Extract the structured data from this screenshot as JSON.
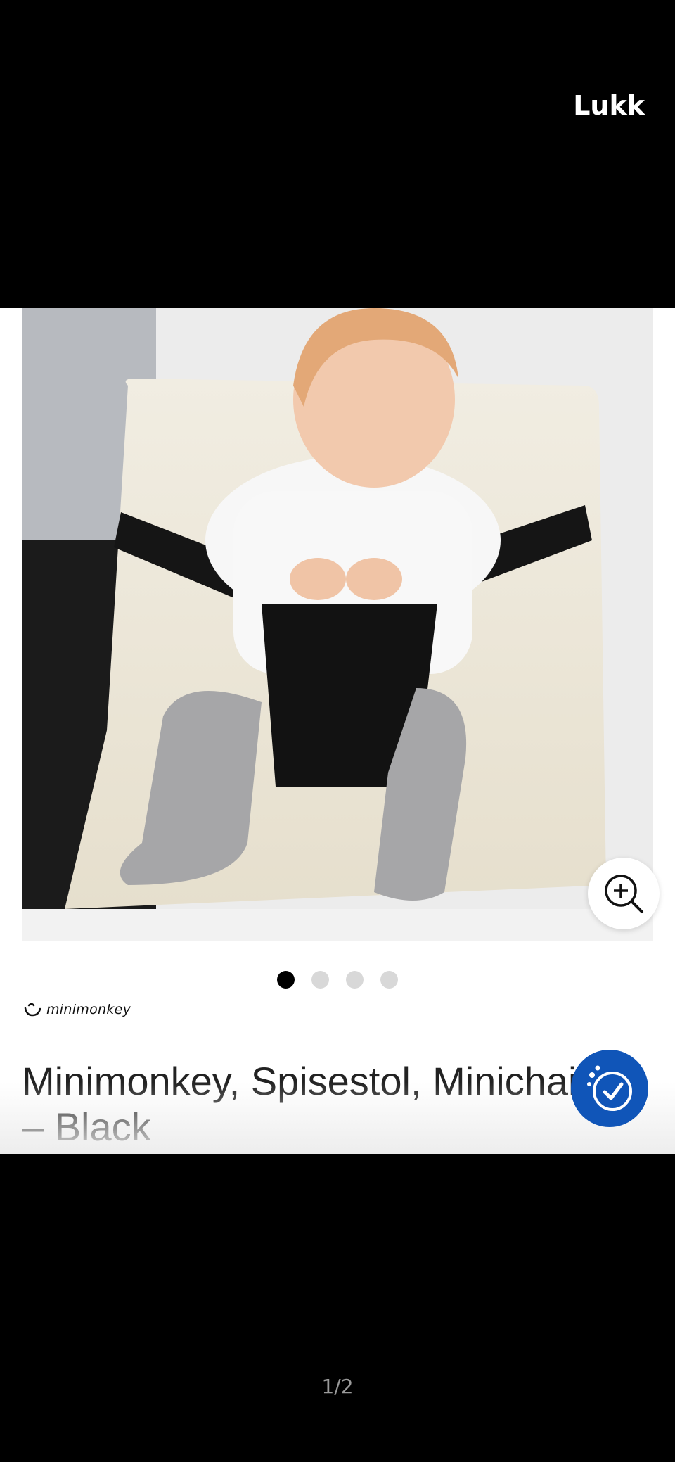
{
  "viewer": {
    "close_label": "Lukk",
    "pager_text": "1/2"
  },
  "product": {
    "brand_name": "minimonkey",
    "title": "Minimonkey, Spisestol, Minichair Po\n– Black",
    "image_alt": "Baby sitting on chair with Minichair",
    "carousel": {
      "count": 4,
      "active_index": 0
    }
  },
  "icons": {
    "zoom": "zoom-in-icon",
    "accessibility": "accessibility-check-icon",
    "brand_logo": "minimonkey-logo-icon"
  },
  "colors": {
    "accent": "#1055b8",
    "dot_active": "#000000",
    "dot_inactive": "#d8d8d8",
    "background": "#000000"
  }
}
